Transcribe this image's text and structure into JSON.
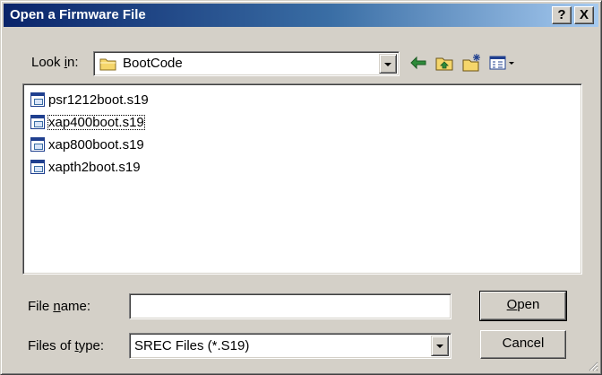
{
  "dialog": {
    "title": "Open a Firmware File",
    "help_button": "?",
    "close_button": "X"
  },
  "look_in": {
    "label_prefix": "Look ",
    "label_accel": "i",
    "label_suffix": "n:",
    "value": "BootCode"
  },
  "toolbar": {
    "icons": [
      "back-arrow-icon",
      "up-folder-icon",
      "new-folder-icon",
      "view-menu-icon"
    ]
  },
  "files": [
    {
      "name": "psr1212boot.s19",
      "focused": false
    },
    {
      "name": "xap400boot.s19",
      "focused": true
    },
    {
      "name": "xap800boot.s19",
      "focused": false
    },
    {
      "name": "xapth2boot.s19",
      "focused": false
    }
  ],
  "file_name": {
    "label_prefix": "File ",
    "label_accel": "n",
    "label_suffix": "ame:",
    "value": ""
  },
  "file_type": {
    "label_prefix": "Files of ",
    "label_accel": "t",
    "label_suffix": "ype:",
    "value": "SREC Files (*.S19)"
  },
  "buttons": {
    "open_accel": "O",
    "open_rest": "pen",
    "cancel": "Cancel"
  },
  "colors": {
    "title_gradient_start": "#0a246a",
    "title_gradient_end": "#a6caf0",
    "face": "#d4d0c8",
    "folder_yellow": "#f5d66b",
    "arrow_green": "#2e8b3a"
  }
}
